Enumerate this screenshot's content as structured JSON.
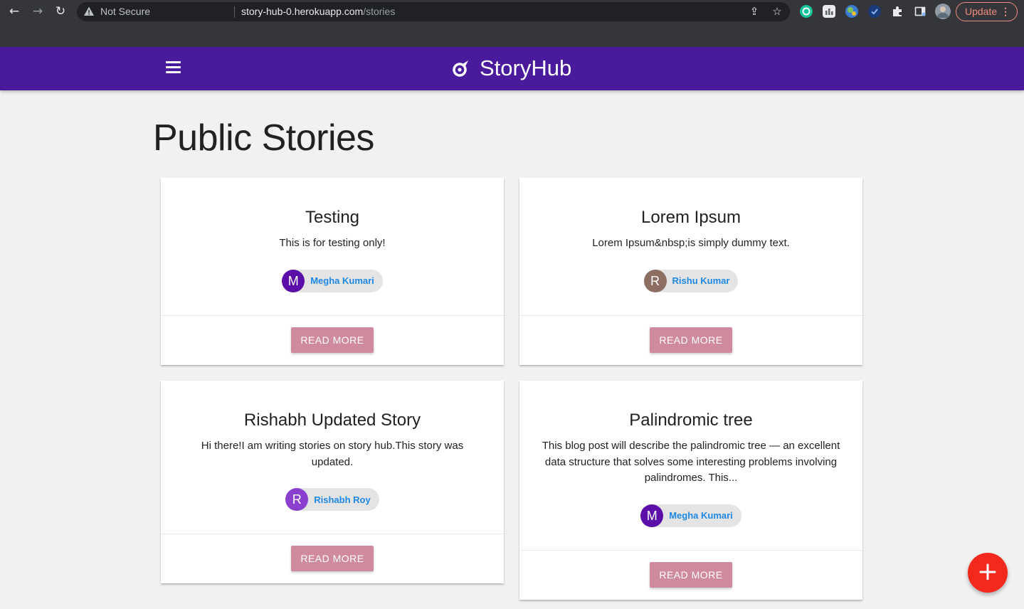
{
  "browser": {
    "security_label": "Not Secure",
    "url_host": "story-hub-0.herokuapp.com",
    "url_path": "/stories",
    "update_label": "Update",
    "update_menu_glyph": "⋮",
    "back_glyph": "←",
    "forward_glyph": "→",
    "reload_glyph": "↻",
    "share_glyph": "⇪",
    "star_glyph": "☆"
  },
  "appbar": {
    "brand": "StoryHub",
    "color": "#4a1a9c"
  },
  "page": {
    "title": "Public Stories"
  },
  "stories": [
    {
      "title": "Testing",
      "description": "This is for testing only!",
      "author": "Megha Kumari",
      "avatar_letter": "M",
      "avatar_color": "#5b0fa8",
      "action_label": "READ MORE"
    },
    {
      "title": "Lorem Ipsum",
      "description": "Lorem Ipsum&nbsp;is simply dummy text.",
      "author": "Rishu Kumar",
      "avatar_letter": "R",
      "avatar_color": "#8d6e63",
      "action_label": "READ MORE"
    },
    {
      "title": "Rishabh Updated Story",
      "description": "Hi there!I am writing stories on story hub.This story was updated.",
      "author": "Rishabh Roy",
      "avatar_letter": "R",
      "avatar_color": "#8a3fcf",
      "action_label": "READ MORE"
    },
    {
      "title": "Palindromic tree",
      "description": "This blog post will describe the palindromic tree — an excellent data structure that solves some interesting problems involving palindromes. This...",
      "author": "Megha Kumari",
      "avatar_letter": "M",
      "avatar_color": "#5b0fa8",
      "action_label": "READ MORE"
    }
  ],
  "fab": {
    "glyph": "+",
    "color": "#f4291d"
  },
  "colors": {
    "read_more": "#d08a9d",
    "author_link": "#1e88e5",
    "background": "#f1f1f1"
  }
}
